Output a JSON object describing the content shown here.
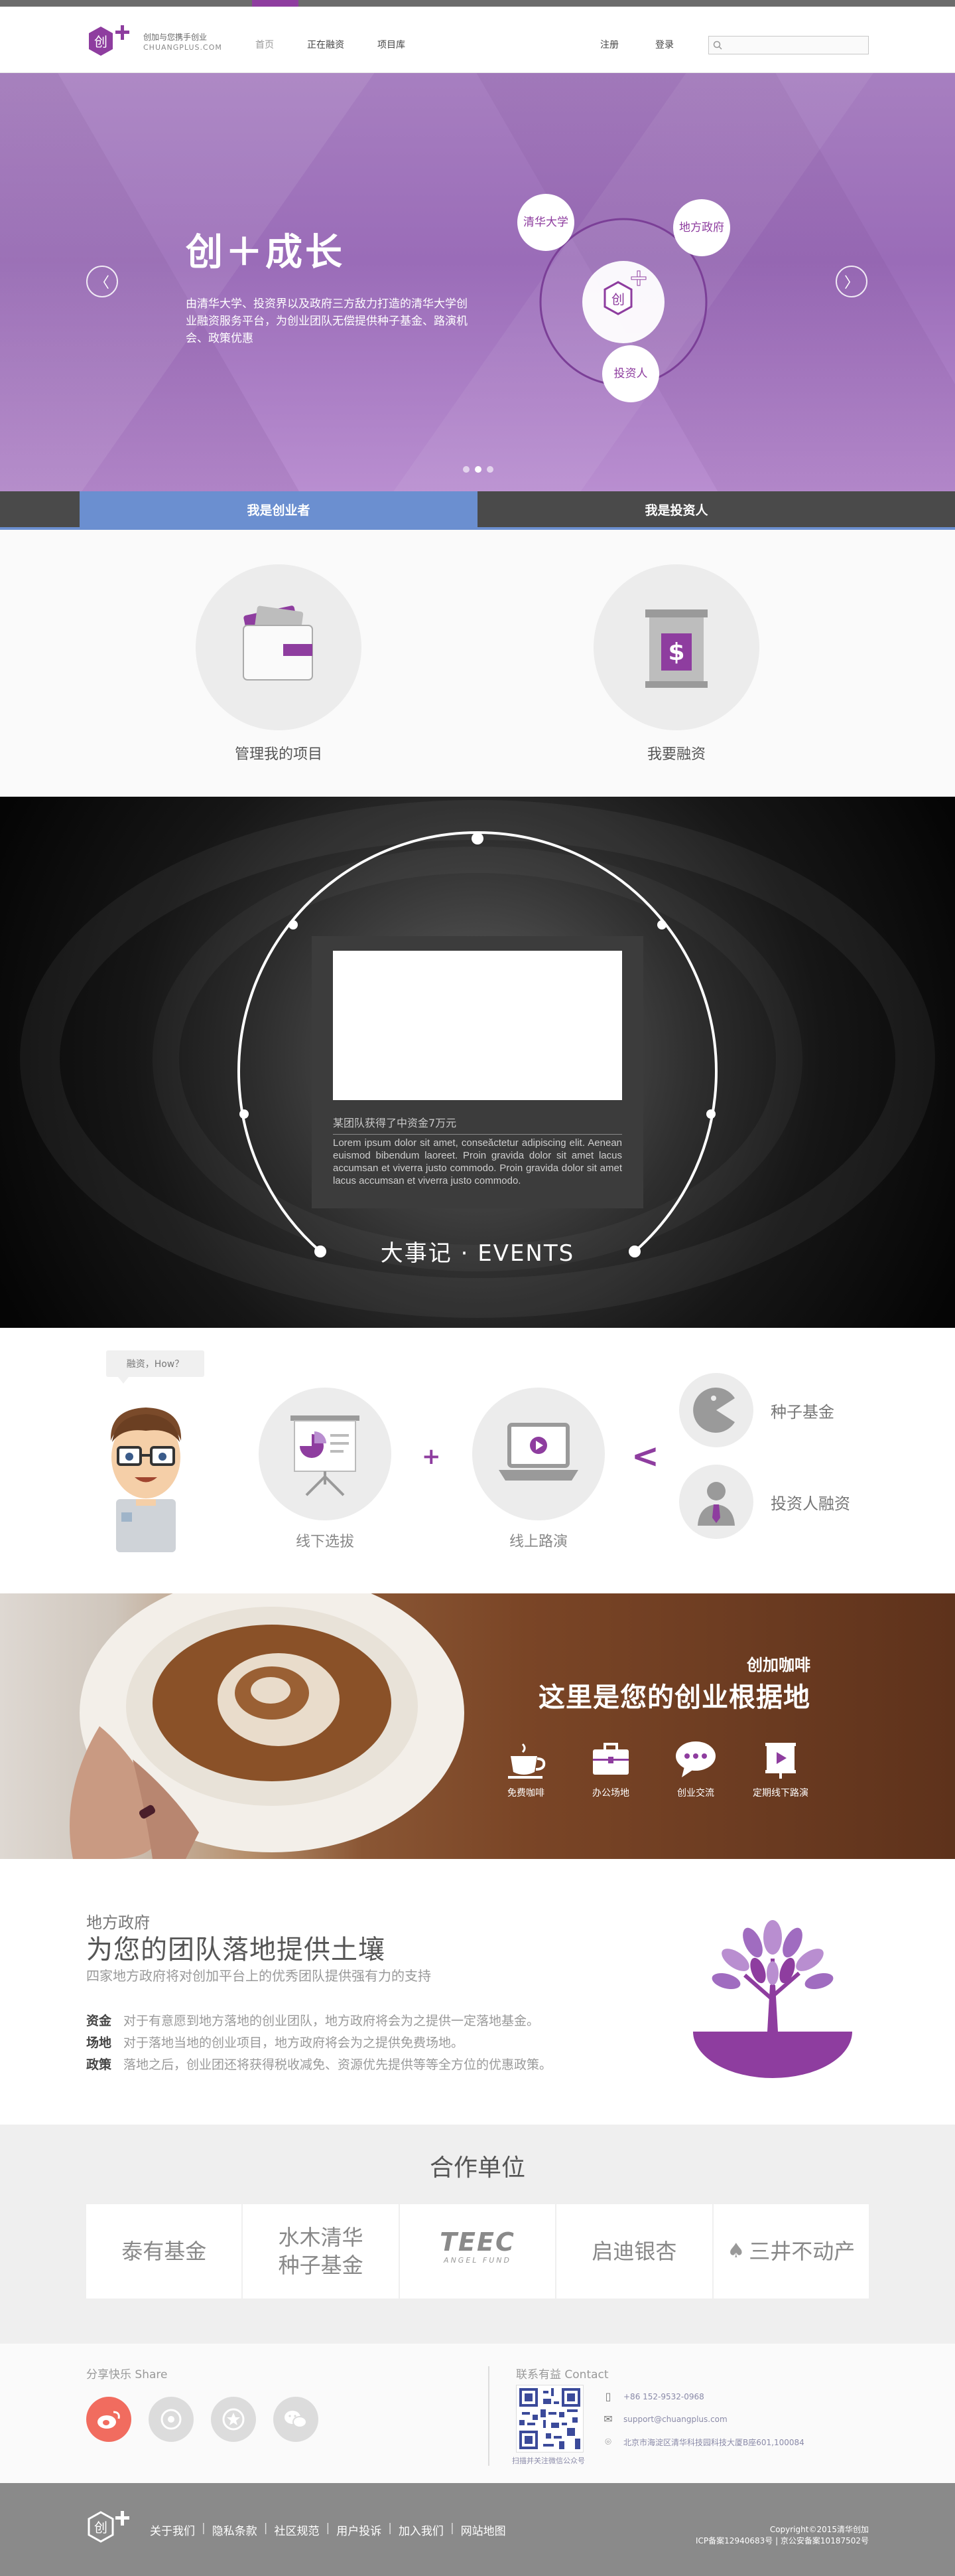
{
  "header": {
    "logo_name": "创加与您携手创业",
    "logo_domain": "CHUANGPLUS.COM",
    "nav": [
      "首页",
      "正在融资",
      "项目库"
    ],
    "register": "注册",
    "login": "登录",
    "search_placeholder": ""
  },
  "hero": {
    "title": "创＋成长",
    "description": "由清华大学、投资界以及政府三方敌力打造的清华大学创业融资服务平台，为创业团队无偿提供种子基金、路演机会、政策优惠",
    "bubbles": {
      "tsinghua": "清华大学",
      "gov": "地方政府",
      "investor": "投资人"
    },
    "prev_arrow": "〈",
    "next_arrow": "〉"
  },
  "roles": {
    "founder_tab": "我是创业者",
    "investor_tab": "我是投资人"
  },
  "features": {
    "manage": "管理我的项目",
    "raise": "我要融资"
  },
  "events": {
    "caption": "某团队获得了中资金7万元",
    "body": "Lorem ipsum dolor sit amet, conseăctetur adipiscing elit. Aenean euismod bibendum laoreet. Proin gravida dolor sit amet lacus accumsan et viverra justo commodo. Proin gravida dolor sit amet lacus accumsan et viverra justo commodo.",
    "title": "大事记 · EVENTS"
  },
  "how": {
    "speech": "融资，How？",
    "offline": "线下选拔",
    "online": "线上路演",
    "seed_fund": "种子基金",
    "investor_fund": "投资人融资"
  },
  "coffee": {
    "sub": "创加咖啡",
    "title": "这里是您的创业根据地",
    "perks": [
      "免费咖啡",
      "办公场地",
      "创业交流",
      "定期线下路演"
    ]
  },
  "gov": {
    "kicker": "地方政府",
    "title": "为您的团队落地提供土壤",
    "subtitle": "四家地方政府将对创加平台上的优秀团队提供强有力的支持",
    "rows": [
      {
        "k": "资金",
        "v": "对于有意愿到地方落地的创业团队，地方政府将会为之提供一定落地基金。"
      },
      {
        "k": "场地",
        "v": "对于落地当地的创业项目，地方政府将会为之提供免费场地。"
      },
      {
        "k": "政策",
        "v": "落地之后，创业团还将获得税收减免、资源优先提供等等全方位的优惠政策。"
      }
    ]
  },
  "partners": {
    "title": "合作单位",
    "items": [
      "泰有基金",
      "水木清华\n种子基金",
      "TEEC",
      "启迪银杏",
      "三井不动产"
    ],
    "teec_sub": "ANGEL FUND"
  },
  "share": {
    "label": "分享快乐 Share",
    "contact_label": "联系有益 Contact",
    "qr_caption": "扫描并关注微信公众号",
    "phone": "+86 152-9532-0968",
    "email": "support@chuangplus.com",
    "address": "北京市海淀区清华科技园科技大厦B座601,100084"
  },
  "footer": {
    "links": [
      "关于我们",
      "隐私条款",
      "社区规范",
      "用户投诉",
      "加入我们",
      "网站地图"
    ],
    "copyright": "Copyright©2015清华创加",
    "icp": "ICP备案12940683号 | 京公安备案10187502号"
  },
  "colors": {
    "brand": "#8e3d9f",
    "tab_active": "#6b8fd0",
    "hero": "#a77fc0"
  }
}
